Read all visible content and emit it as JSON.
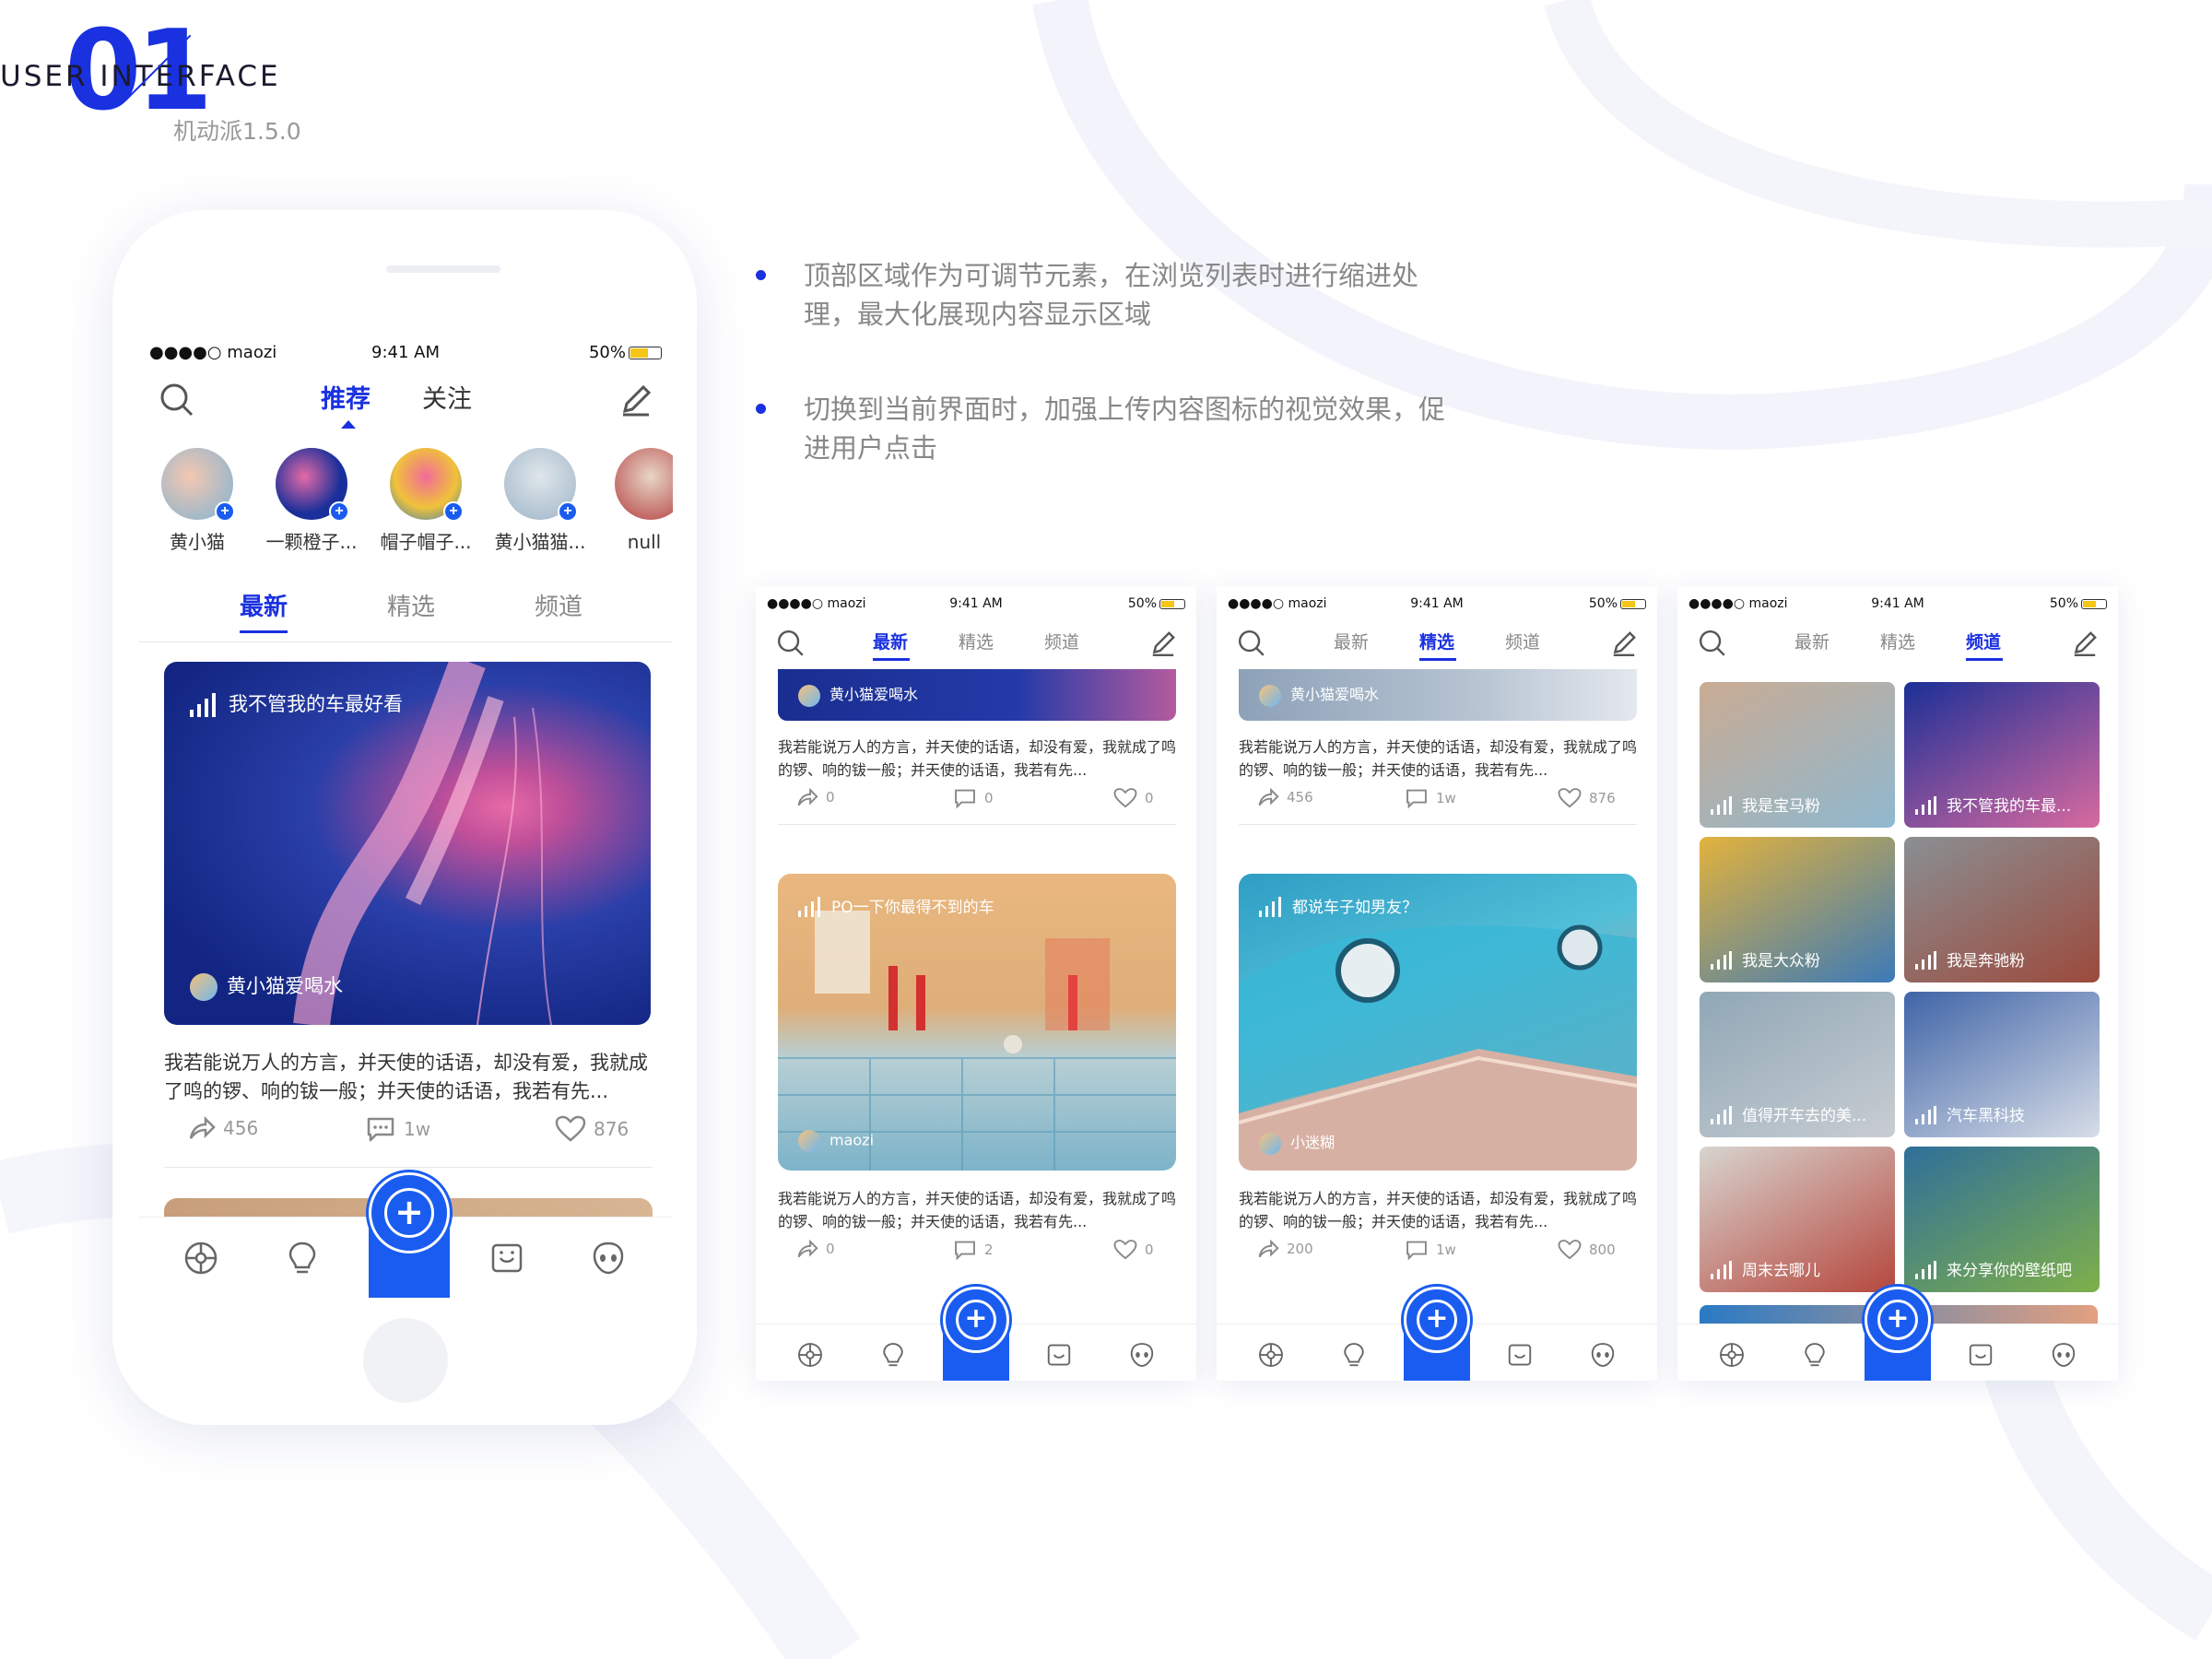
{
  "header": {
    "number": "01",
    "title": "USER INTERFACE",
    "version": "机动派1.5.0"
  },
  "bullets": [
    {
      "line1": "顶部区域作为可调节元素，在浏览列表时进行缩进处",
      "line2": "理，最大化展现内容显示区域"
    },
    {
      "line1": "切换到当前界面时，加强上传内容图标的视觉效果，促",
      "line2": "进用户点击"
    }
  ],
  "status": {
    "carrier": "●●●●○ maozi",
    "time": "9:41 AM",
    "battery": "50%"
  },
  "big_phone": {
    "top_tabs": [
      "推荐",
      "关注"
    ],
    "active_top_tab": "推荐",
    "stories": [
      {
        "name": "黄小猫",
        "color": "#e8a6a0"
      },
      {
        "name": "一颗橙子...",
        "color": "#1a2f9a"
      },
      {
        "name": "帽子帽子...",
        "color": "#f0c23a"
      },
      {
        "name": "黄小猫猫...",
        "color": "#9fb5c8"
      },
      {
        "name": "null",
        "color": "#c9b8a8"
      }
    ],
    "feed_tabs": [
      "最新",
      "精选",
      "频道"
    ],
    "active_feed_tab": "最新",
    "card": {
      "title": "我不管我的车最好看",
      "author": "黄小猫爱喝水",
      "description": "我若能说万人的方言，并天使的话语，却没有爱，我就成了鸣的锣、响的钹一般；并天使的话语，我若有先...",
      "shares": "456",
      "comments": "1w",
      "likes": "876"
    }
  },
  "screen_latest": {
    "tabs": [
      "最新",
      "精选",
      "频道"
    ],
    "active": "最新",
    "top_author": "黄小猫爱喝水",
    "desc": "我若能说万人的方言，并天使的话语，却没有爱，我就成了鸣的锣、响的钹一般；并天使的话语，我若有先...",
    "top_counts": {
      "shares": "0",
      "comments": "0",
      "likes": "0"
    },
    "card_title": "PO一下你最得不到的车",
    "card_author": "maozi",
    "counts": {
      "shares": "0",
      "comments": "2",
      "likes": "0"
    }
  },
  "screen_featured": {
    "tabs": [
      "最新",
      "精选",
      "频道"
    ],
    "active": "精选",
    "top_author": "黄小猫爱喝水",
    "desc": "我若能说万人的方言，并天使的话语，却没有爱，我就成了鸣的锣、响的钹一般；并天使的话语，我若有先...",
    "top_counts": {
      "shares": "456",
      "comments": "1w",
      "likes": "876"
    },
    "card_title": "都说车子如男友？",
    "card_author": "小迷糊",
    "counts": {
      "shares": "200",
      "comments": "1w",
      "likes": "800"
    }
  },
  "screen_channels": {
    "tabs": [
      "最新",
      "精选",
      "频道"
    ],
    "active": "频道",
    "channels": [
      {
        "name": "我是宝马粉",
        "c1": "#c9ab93",
        "c2": "#8fb8cf"
      },
      {
        "name": "我不管我的车最...",
        "c1": "#1b2f96",
        "c2": "#d86aa0"
      },
      {
        "name": "我是大众粉",
        "c1": "#e3b23c",
        "c2": "#3b7ab8"
      },
      {
        "name": "我是奔驰粉",
        "c1": "#8a8f93",
        "c2": "#9c4a3c"
      },
      {
        "name": "值得开车去的美...",
        "c1": "#90a7b6",
        "c2": "#c8cdd2"
      },
      {
        "name": "汽车黑科技",
        "c1": "#3f64a7",
        "c2": "#d7dde7"
      },
      {
        "name": "周末去哪儿",
        "c1": "#d8d4cf",
        "c2": "#b5473d"
      },
      {
        "name": "来分享你的壁纸吧",
        "c1": "#2f6f9a",
        "c2": "#7fb04a"
      }
    ]
  },
  "tabbar_icons": [
    "wheel-icon",
    "bulb-icon",
    "add-icon",
    "face-icon",
    "alien-icon"
  ]
}
